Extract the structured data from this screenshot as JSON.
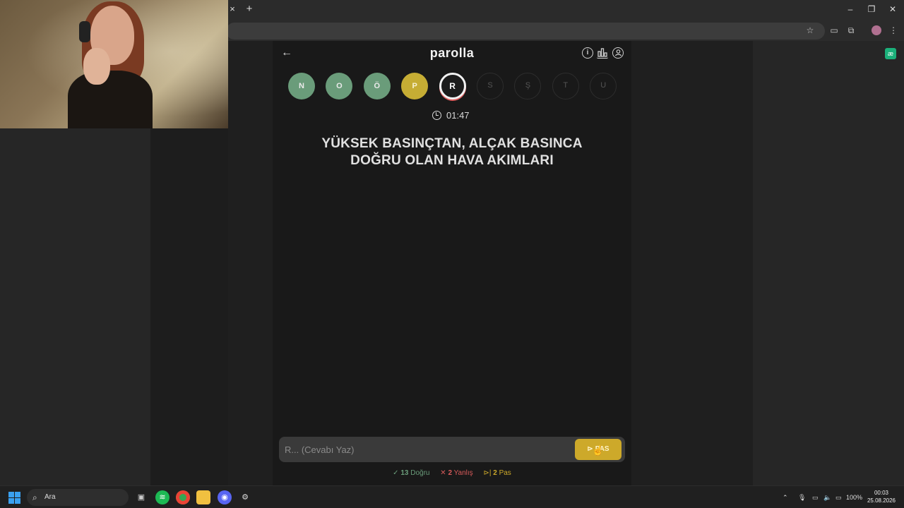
{
  "browser": {
    "close_tab": "×",
    "new_tab": "+",
    "minimize": "–",
    "restore": "❐",
    "close_window": "✕"
  },
  "game": {
    "back_icon": "←",
    "title": "parolla",
    "info_icon": "i",
    "letters": [
      {
        "letter": "N",
        "status": "correct"
      },
      {
        "letter": "O",
        "status": "correct"
      },
      {
        "letter": "Ö",
        "status": "correct"
      },
      {
        "letter": "P",
        "status": "pass"
      },
      {
        "letter": "R",
        "status": "current"
      },
      {
        "letter": "S",
        "status": "pending"
      },
      {
        "letter": "Ş",
        "status": "pending"
      },
      {
        "letter": "T",
        "status": "pending"
      },
      {
        "letter": "U",
        "status": "pending"
      }
    ],
    "timer": "01:47",
    "question_line1": "YÜKSEK BASINÇTAN, ALÇAK BASINCA",
    "question_line2": "DOĞRU OLAN HAVA AKIMLARI",
    "answer_placeholder": "R... (Cevabı Yaz)",
    "pas_label": "PAS",
    "stats": {
      "correct_count": "13",
      "correct_label": "Doğru",
      "wrong_count": "2",
      "wrong_label": "Yanlış",
      "pass_count": "2",
      "pass_label": "Pas"
    }
  },
  "taskbar": {
    "search_placeholder": "Ara",
    "battery": "100%",
    "time": "00:03",
    "date": "25.08.2026"
  },
  "colors": {
    "correct": "#6a9c7a",
    "pass": "#c6ad34",
    "wrong": "#d75a5a"
  }
}
